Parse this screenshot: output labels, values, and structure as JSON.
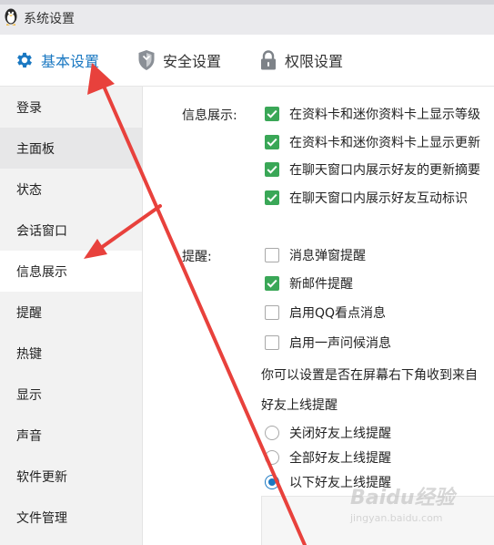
{
  "window": {
    "title": "系统设置"
  },
  "tabs": [
    {
      "label": "基本设置",
      "icon": "gear-icon",
      "active": true
    },
    {
      "label": "安全设置",
      "icon": "shield-icon",
      "active": false
    },
    {
      "label": "权限设置",
      "icon": "lock-icon",
      "active": false
    }
  ],
  "sidebar": {
    "items": [
      {
        "label": "登录"
      },
      {
        "label": "主面板"
      },
      {
        "label": "状态"
      },
      {
        "label": "会话窗口"
      },
      {
        "label": "信息展示"
      },
      {
        "label": "提醒"
      },
      {
        "label": "热键"
      },
      {
        "label": "显示"
      },
      {
        "label": "声音"
      },
      {
        "label": "软件更新"
      },
      {
        "label": "文件管理"
      }
    ],
    "active_label": "信息展示"
  },
  "info_display": {
    "label": "信息展示:",
    "options": [
      {
        "label": "在资料卡和迷你资料卡上显示等级",
        "checked": true
      },
      {
        "label": "在资料卡和迷你资料卡上显示更新",
        "checked": true
      },
      {
        "label": "在聊天窗口内展示好友的更新摘要",
        "checked": true
      },
      {
        "label": "在聊天窗口内展示好友互动标识",
        "checked": true
      }
    ]
  },
  "reminder": {
    "label": "提醒:",
    "options": [
      {
        "label": "消息弹窗提醒",
        "checked": false
      },
      {
        "label": "新邮件提醒",
        "checked": true
      },
      {
        "label": "启用QQ看点消息",
        "checked": false
      },
      {
        "label": "启用一声问候消息",
        "checked": false
      }
    ],
    "description": "你可以设置是否在屏幕右下角收到来自",
    "friend_online": {
      "title": "好友上线提醒",
      "options": [
        {
          "label": "关闭好友上线提醒",
          "selected": false
        },
        {
          "label": "全部好友上线提醒",
          "selected": false
        },
        {
          "label": "以下好友上线提醒",
          "selected": true
        }
      ]
    }
  },
  "watermark": {
    "brand": "Baidu经验",
    "url": "jingyan.baidu.com"
  },
  "colors": {
    "accent": "#1a78c2",
    "check": "#3aa757",
    "arrow": "#e8413c"
  }
}
